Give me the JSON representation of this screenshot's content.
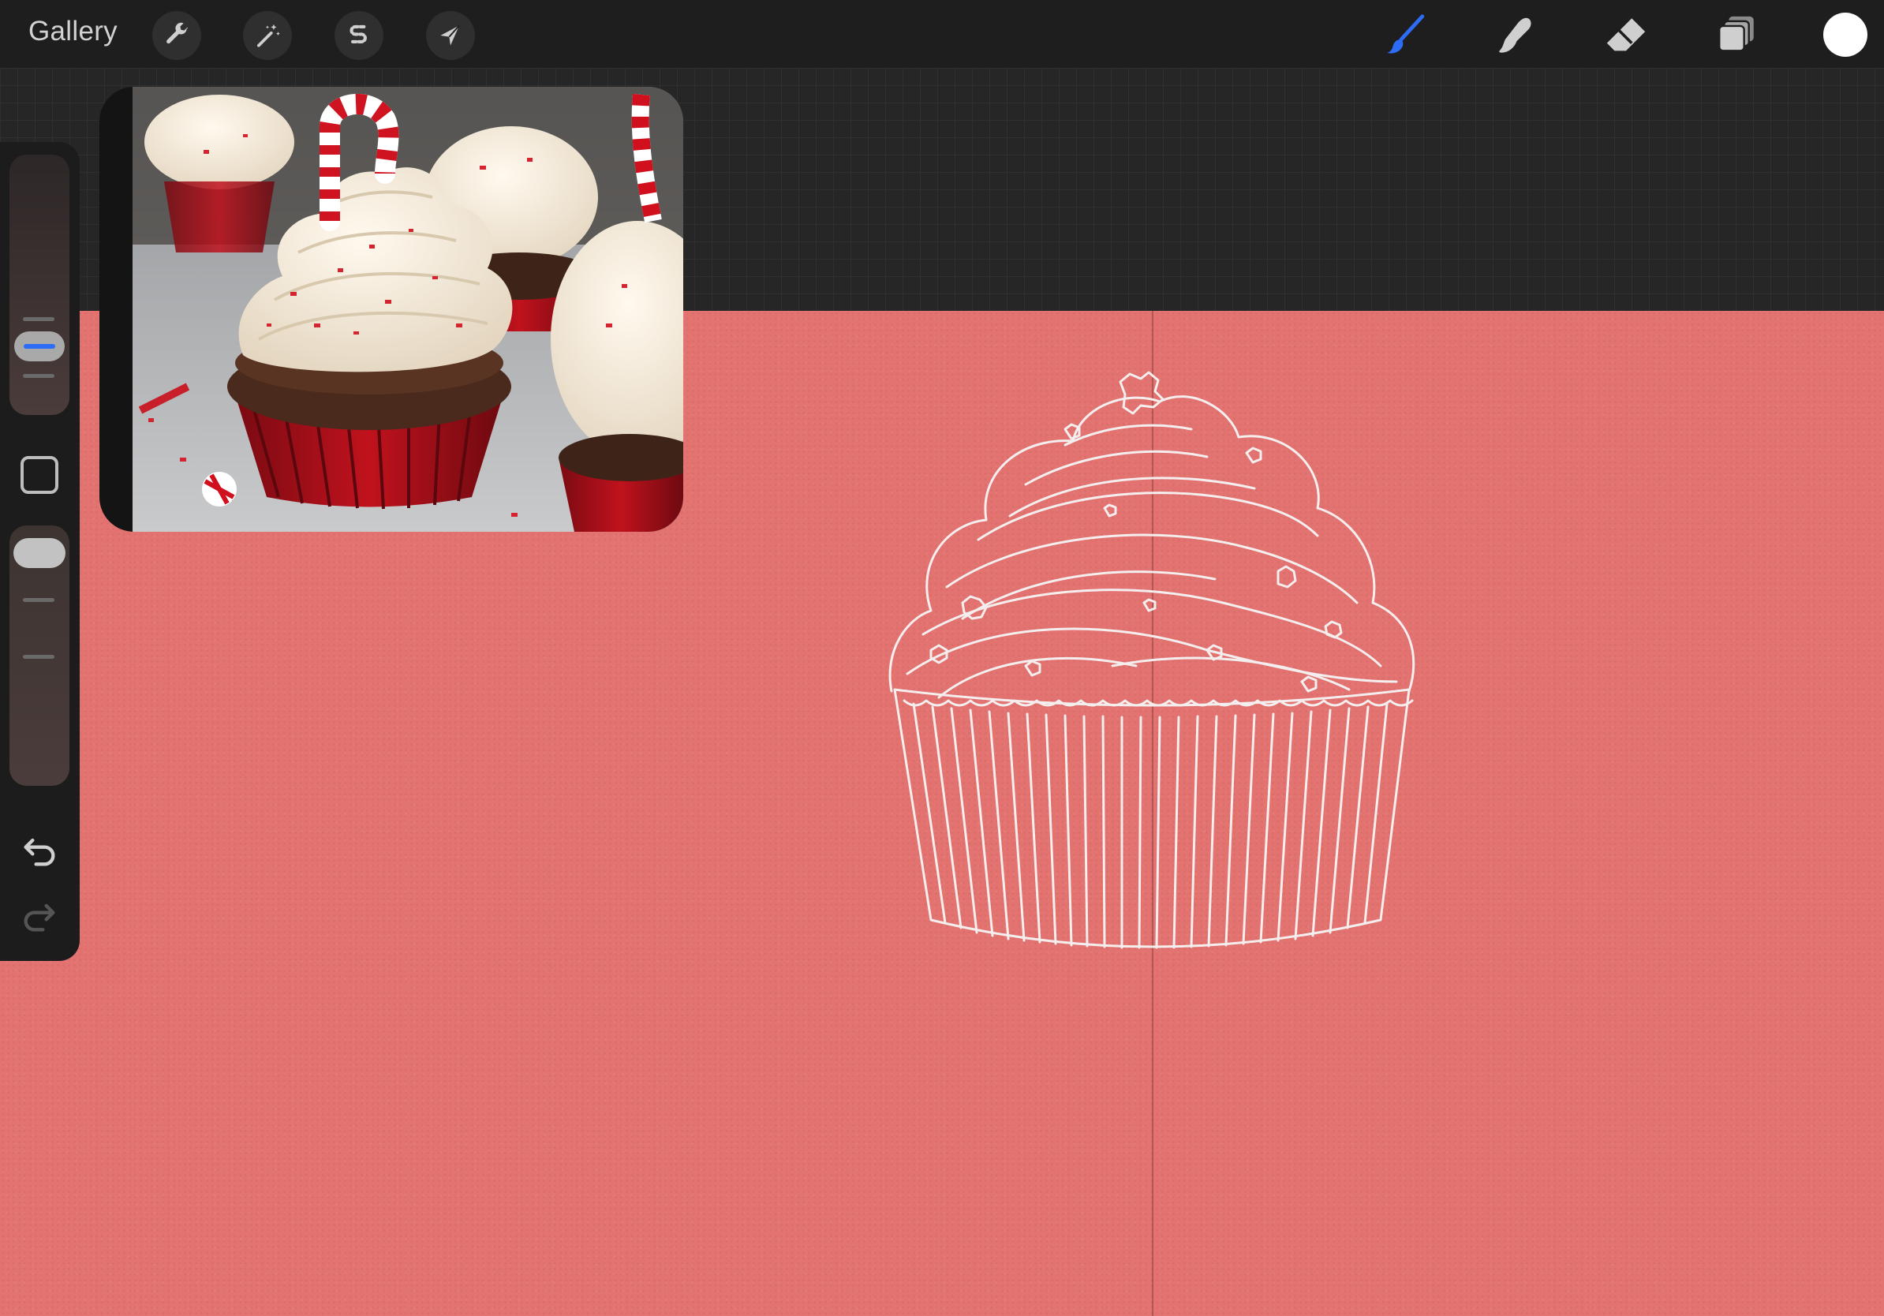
{
  "toolbar": {
    "gallery_label": "Gallery",
    "left_tools": [
      {
        "name": "actions",
        "icon": "wrench-icon"
      },
      {
        "name": "adjustments",
        "icon": "magic-wand-icon"
      },
      {
        "name": "selection",
        "icon": "selection-s-icon"
      },
      {
        "name": "transform",
        "icon": "arrow-cursor-icon"
      }
    ],
    "right_tools": [
      {
        "name": "paint",
        "icon": "brush-icon",
        "active": true
      },
      {
        "name": "smudge",
        "icon": "smudge-finger-icon",
        "active": false
      },
      {
        "name": "erase",
        "icon": "eraser-icon",
        "active": false
      },
      {
        "name": "layers",
        "icon": "layers-icon",
        "active": false
      }
    ],
    "current_color": "#ffffff",
    "accent_color": "#2d6df6"
  },
  "sidebar": {
    "brush_size_icon": "size-slider",
    "modify_icon": "square-icon",
    "opacity_icon": "opacity-slider",
    "undo_icon": "undo-icon",
    "redo_icon": "redo-icon"
  },
  "canvas": {
    "background_color": "#e37370",
    "symmetry_guide": "vertical",
    "subject": "cupcake-sketch"
  },
  "reference": {
    "subject": "peppermint-cupcakes-photo"
  }
}
